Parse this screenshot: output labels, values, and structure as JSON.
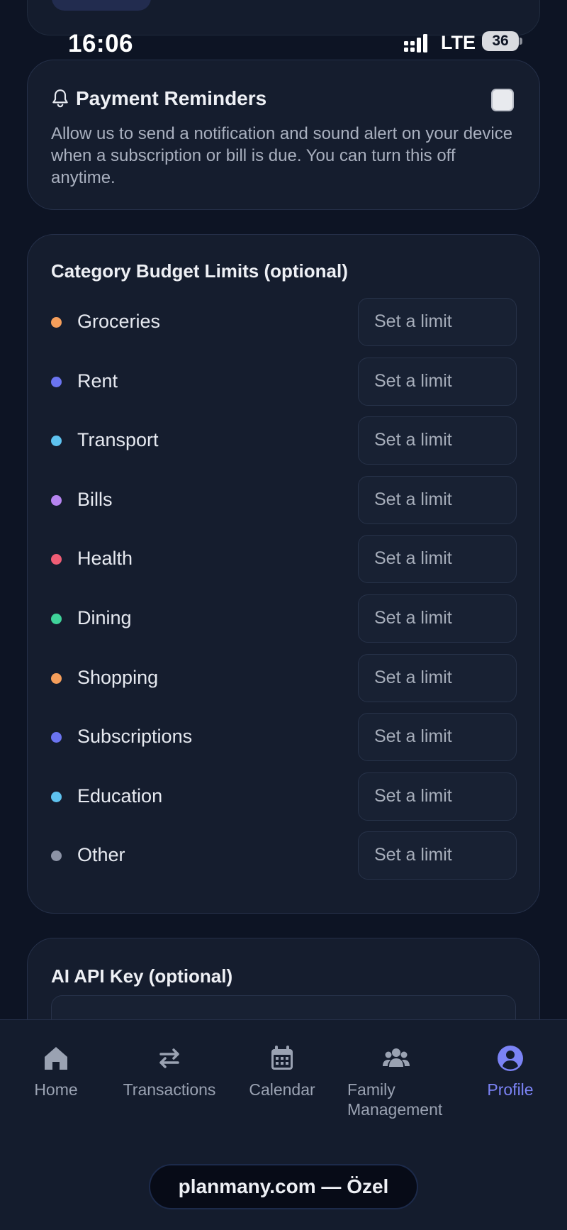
{
  "status_bar": {
    "time": "16:06",
    "network": "LTE",
    "battery": "36"
  },
  "reminders": {
    "title": "Payment Reminders",
    "description": "Allow us to send a notification and sound alert on your device when a subscription or bill is due. You can turn this off anytime.",
    "enabled": false
  },
  "budget": {
    "title": "Category Budget Limits (optional)",
    "categories": [
      {
        "label": "Groceries",
        "color": "#f59e5b",
        "placeholder": "Set a limit"
      },
      {
        "label": "Rent",
        "color": "#6b74f0",
        "placeholder": "Set a limit"
      },
      {
        "label": "Transport",
        "color": "#5ec2ef",
        "placeholder": "Set a limit"
      },
      {
        "label": "Bills",
        "color": "#b684f0",
        "placeholder": "Set a limit"
      },
      {
        "label": "Health",
        "color": "#ef5d75",
        "placeholder": "Set a limit"
      },
      {
        "label": "Dining",
        "color": "#3fd39a",
        "placeholder": "Set a limit"
      },
      {
        "label": "Shopping",
        "color": "#f59e5b",
        "placeholder": "Set a limit"
      },
      {
        "label": "Subscriptions",
        "color": "#6b74f0",
        "placeholder": "Set a limit"
      },
      {
        "label": "Education",
        "color": "#5ec2ef",
        "placeholder": "Set a limit"
      },
      {
        "label": "Other",
        "color": "#8c93a6",
        "placeholder": "Set a limit"
      }
    ]
  },
  "api_key": {
    "title": "AI API Key (optional)"
  },
  "nav": {
    "items": [
      {
        "label": "Home",
        "icon": "home-icon"
      },
      {
        "label": "Transactions",
        "icon": "transfer-arrows-icon"
      },
      {
        "label": "Calendar",
        "icon": "calendar-icon"
      },
      {
        "label": "Family Management",
        "icon": "family-group-icon"
      },
      {
        "label": "Profile",
        "icon": "profile-icon",
        "active": true
      }
    ],
    "active_color": "#7b83f5"
  },
  "footer": {
    "domain": "planmany.com — Özel"
  }
}
